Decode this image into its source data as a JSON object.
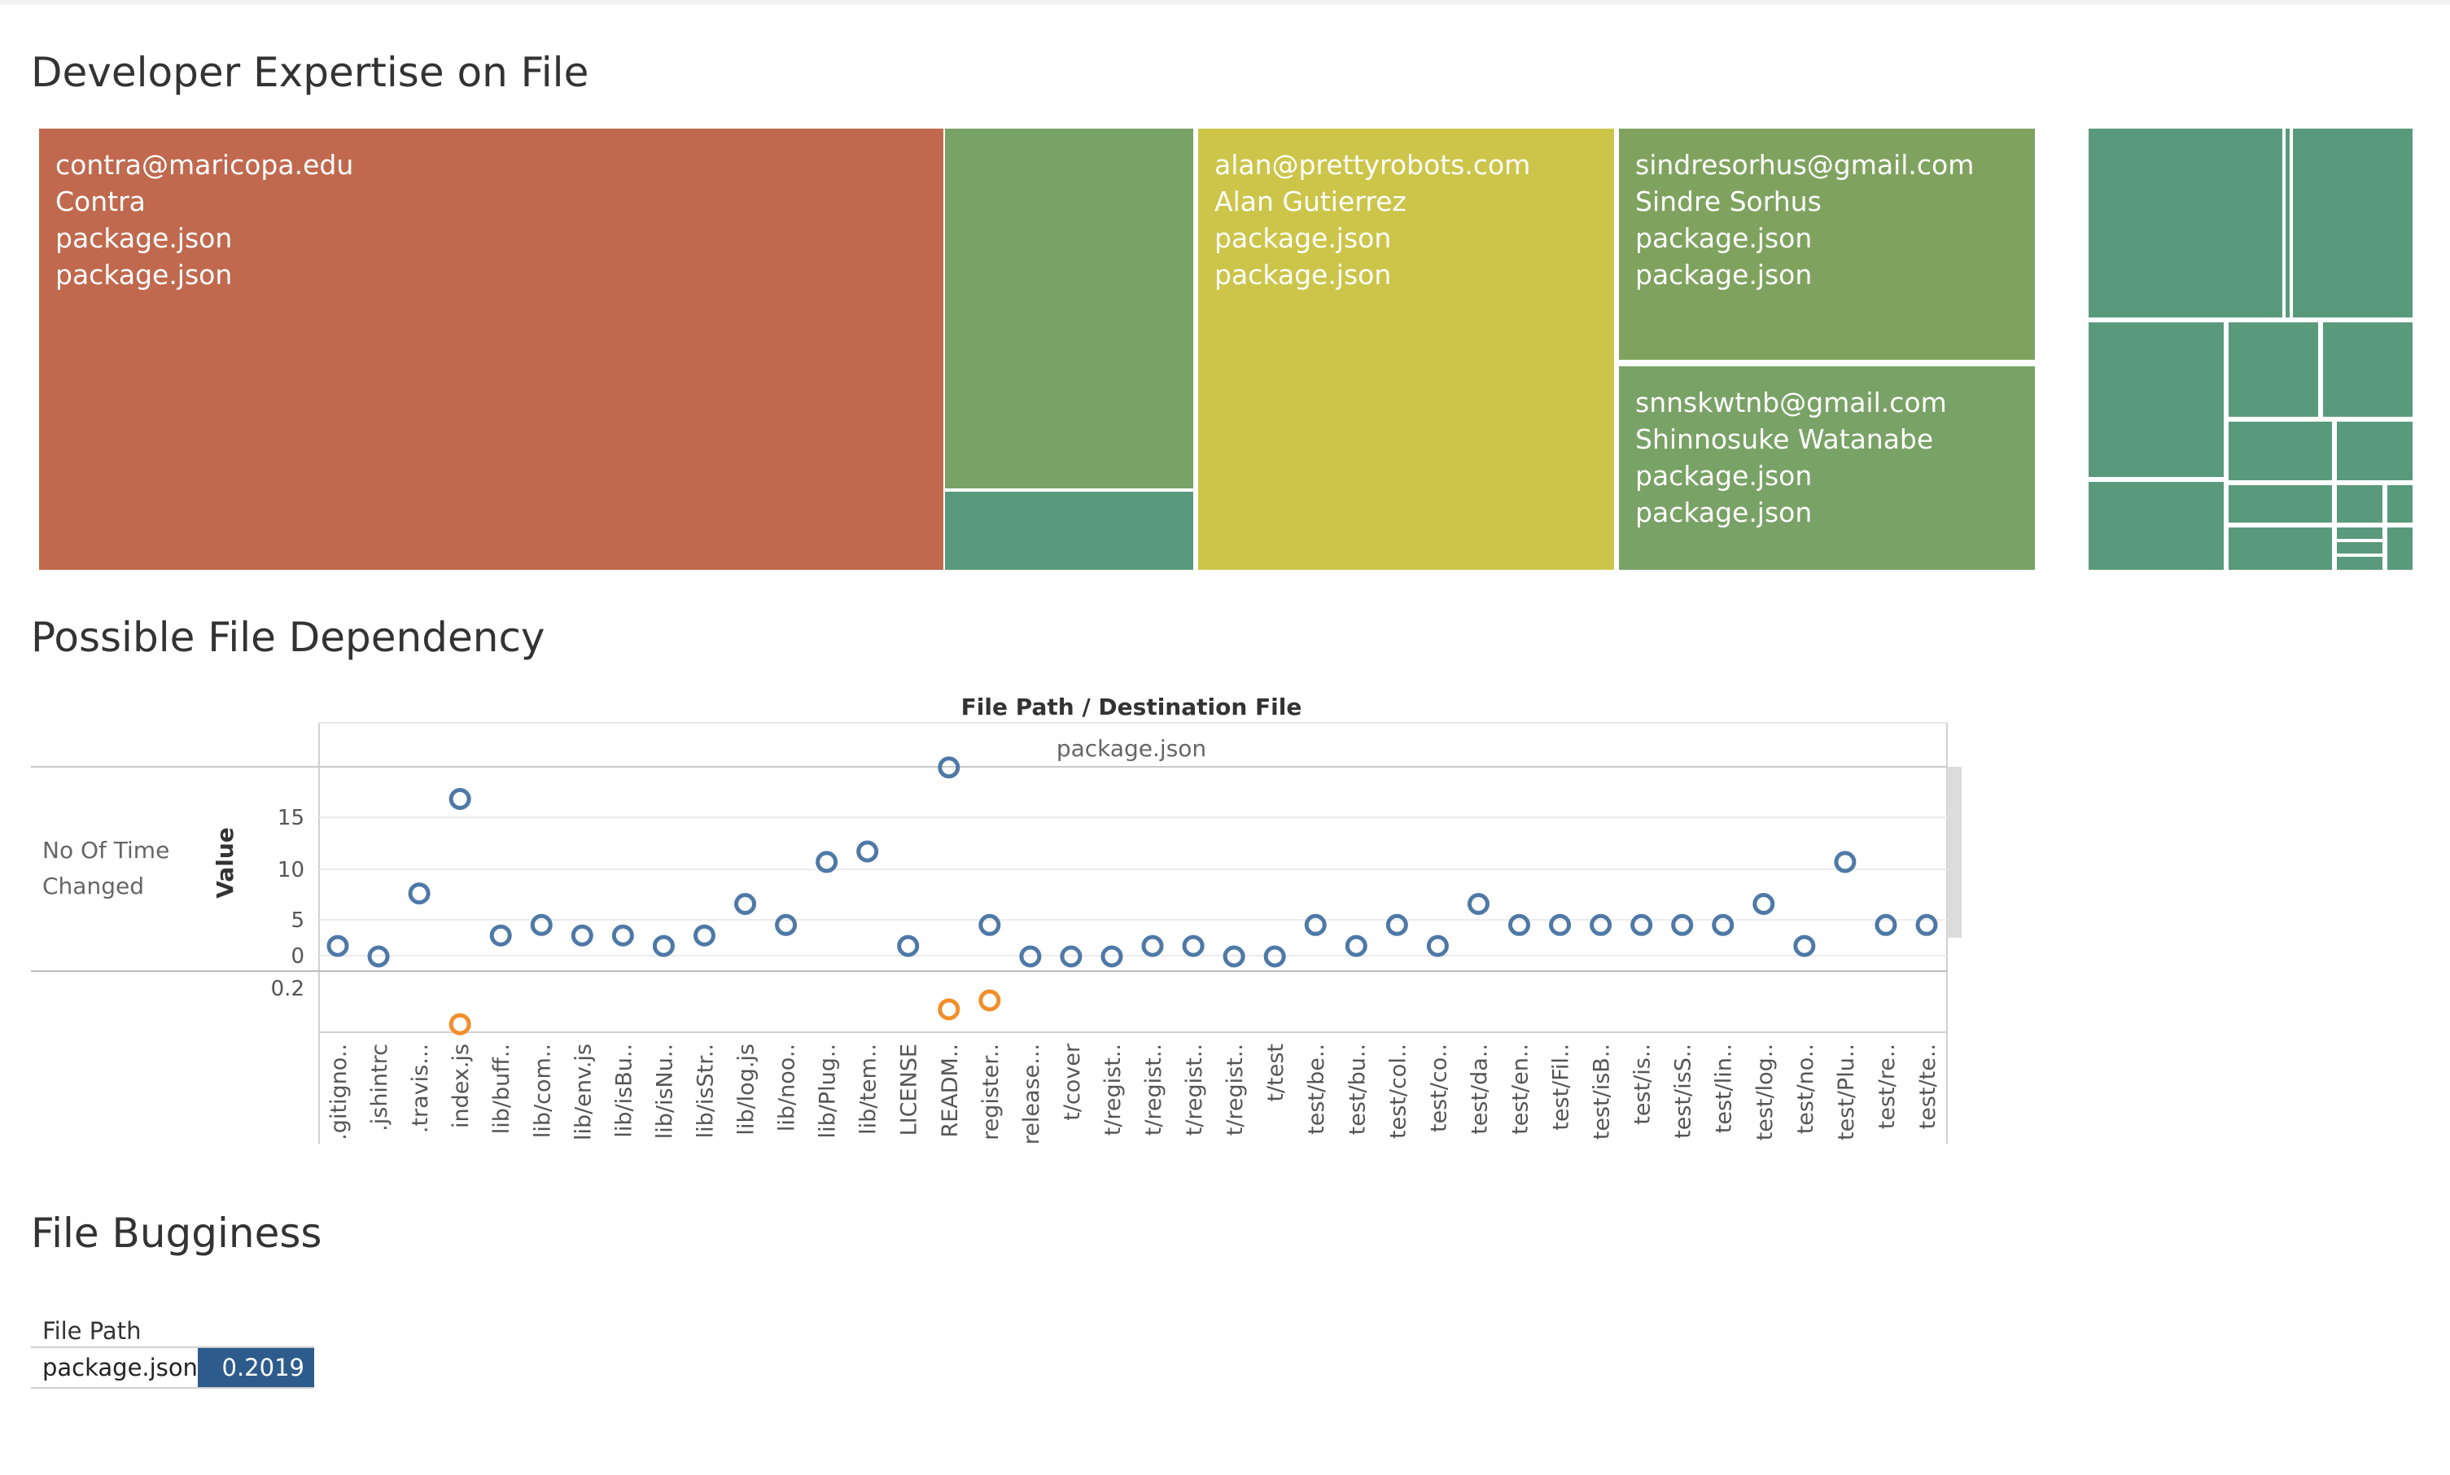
{
  "colors": {
    "contra": "#c0694e",
    "alan": "#ccc54a",
    "green_mid": "#79a266",
    "green_light": "#7fa35f",
    "green_sindre": "#7fa35f",
    "teal": "#5a9a7c",
    "series_value": "#4e79a7",
    "series_prob": "#f28e2b",
    "bug_cell": "#2d5b8c"
  },
  "sections": {
    "expertise_title": "Developer Expertise on File",
    "dependency_title": "Possible File Dependency",
    "bugginess_title": "File Bugginess"
  },
  "treemap": {
    "tiles": [
      {
        "id": "contra",
        "lines": [
          "contra@maricopa.edu",
          "Contra",
          "package.json",
          "package.json"
        ]
      },
      {
        "id": "alan",
        "lines": [
          "alan@prettyrobots.com",
          "Alan Gutierrez",
          "package.json",
          "package.json"
        ]
      },
      {
        "id": "sindre",
        "lines": [
          "sindresorhus@gmail.com",
          "Sindre Sorhus",
          "package.json",
          "package.json"
        ]
      },
      {
        "id": "snnskwtnb",
        "lines": [
          "snnskwtnb@gmail.com",
          "Shinnosuke Watanabe",
          "package.json",
          "package.json"
        ]
      }
    ]
  },
  "dependency": {
    "header_title": "File Path  /  Destination File",
    "header_sub": "package.json",
    "row_label_line1": "No Of Time",
    "row_label_line2": "Changed",
    "axis_title": "Value",
    "y_ticks": [
      "15",
      "10",
      "5",
      "0"
    ],
    "lower_tick": "0.2"
  },
  "chart_data": {
    "type": "scatter",
    "title": "",
    "xlabel": "",
    "ylabel": "Value",
    "categories": [
      ".gitigno..",
      ".jshintrc",
      ".travis...",
      "index.js",
      "lib/buff..",
      "lib/com..",
      "lib/env.js",
      "lib/isBu..",
      "lib/isNu..",
      "lib/isStr..",
      "lib/log.js",
      "lib/noo..",
      "lib/Plug..",
      "lib/tem..",
      "LICENSE",
      "READM..",
      "register..",
      "release...",
      "t/cover",
      "t/regist..",
      "t/regist..",
      "t/regist..",
      "t/regist..",
      "t/test",
      "test/be..",
      "test/bu..",
      "test/col..",
      "test/co..",
      "test/da..",
      "test/en..",
      "test/Fil..",
      "test/isB..",
      "test/is..",
      "test/isS..",
      "test/lin..",
      "test/log..",
      "test/no..",
      "test/Plu..",
      "test/re..",
      "test/te.."
    ],
    "series": [
      {
        "values": [
          1,
          0,
          6,
          15,
          2,
          3,
          2,
          2,
          1,
          2,
          5,
          3,
          9,
          10,
          1,
          18,
          3,
          0,
          0,
          0,
          1,
          1,
          0,
          0,
          3,
          1,
          3,
          1,
          5,
          3,
          3,
          3,
          3,
          3,
          3,
          5,
          1,
          9,
          3,
          3
        ]
      },
      {
        "values": [
          null,
          null,
          null,
          0.12,
          null,
          null,
          null,
          null,
          null,
          null,
          null,
          null,
          null,
          null,
          null,
          0.17,
          0.2,
          null,
          null,
          null,
          null,
          null,
          null,
          null,
          null,
          null,
          null,
          null,
          null,
          null,
          null,
          null,
          null,
          null,
          null,
          null,
          null,
          null,
          null,
          null
        ]
      }
    ],
    "ylim": [
      0,
      20
    ],
    "grid": true
  },
  "bugginess": {
    "header": "File Path",
    "rows": [
      {
        "path": "package.json",
        "value": "0.2019"
      }
    ]
  }
}
